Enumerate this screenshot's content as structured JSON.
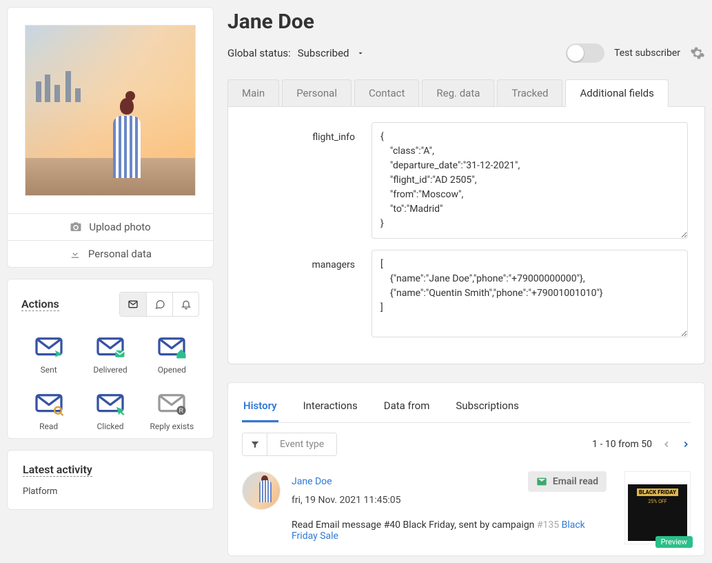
{
  "profile": {
    "name": "Jane Doe",
    "global_status_label": "Global status:",
    "global_status_value": "Subscribed",
    "test_subscriber_label": "Test subscriber",
    "upload_photo": "Upload photo",
    "personal_data": "Personal data"
  },
  "tabs": {
    "main": "Main",
    "personal": "Personal",
    "contact": "Contact",
    "reg_data": "Reg. data",
    "tracked": "Tracked",
    "additional": "Additional fields"
  },
  "additional_fields": {
    "flight_info_label": "flight_info",
    "flight_info_value": "{\n    \"class\":\"A\",\n    \"departure_date\":\"31-12-2021\",\n    \"flight_id\":\"AD 2505\",\n    \"from\":\"Moscow\",\n    \"to\":\"Madrid\"\n}",
    "managers_label": "managers",
    "managers_value": "[\n    {\"name\":\"Jane Doe\",\"phone\":\"+79000000000\"},\n    {\"name\":\"Quentin Smith\",\"phone\":\"+79001001010\"}\n]"
  },
  "actions": {
    "title": "Actions",
    "sent": "Sent",
    "delivered": "Delivered",
    "opened": "Opened",
    "read": "Read",
    "clicked": "Clicked",
    "reply_exists": "Reply exists"
  },
  "latest": {
    "title": "Latest activity",
    "platform": "Platform"
  },
  "history": {
    "tabs": {
      "history": "History",
      "interactions": "Interactions",
      "data_from": "Data from",
      "subscriptions": "Subscriptions"
    },
    "event_type_label": "Event type",
    "pager": "1 - 10 from 50",
    "entry": {
      "user": "Jane Doe",
      "date": "fri, 19 Nov. 2021 11:45:05",
      "badge": "Email read",
      "desc_prefix": "Read Email message #40 Black Friday, sent by campaign ",
      "desc_dim": "#135 ",
      "desc_link": "Black Friday Sale",
      "preview_tag": "Preview",
      "preview_title": "BLACK FRIDAY",
      "preview_sub": "25% OFF"
    }
  }
}
